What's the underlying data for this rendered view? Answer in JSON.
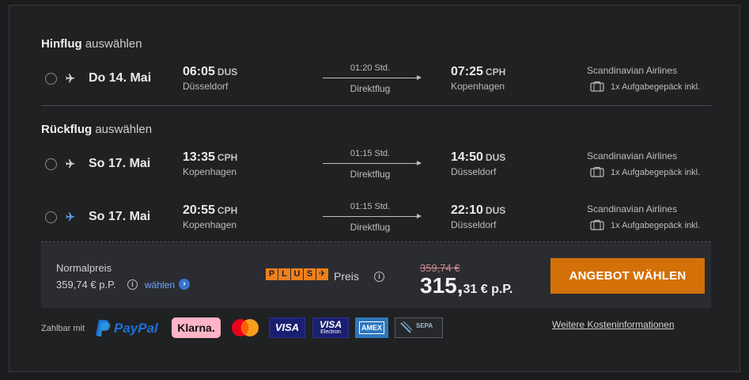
{
  "outbound": {
    "title_bold": "Hinflug",
    "title_rest": "auswählen",
    "flights": [
      {
        "date": "Do 14. Mai",
        "dep_time": "06:05",
        "dep_iata": "DUS",
        "dep_city": "Düsseldorf",
        "duration": "01:20 Std.",
        "stops": "Direktflug",
        "arr_time": "07:25",
        "arr_iata": "CPH",
        "arr_city": "Kopenhagen",
        "airline": "Scandinavian Airlines",
        "baggage": "1x Aufgabegepäck inkl."
      }
    ]
  },
  "return": {
    "title_bold": "Rückflug",
    "title_rest": "auswählen",
    "flights": [
      {
        "date": "So 17. Mai",
        "dep_time": "13:35",
        "dep_iata": "CPH",
        "dep_city": "Kopenhagen",
        "duration": "01:15 Std.",
        "stops": "Direktflug",
        "arr_time": "14:50",
        "arr_iata": "DUS",
        "arr_city": "Düsseldorf",
        "airline": "Scandinavian Airlines",
        "baggage": "1x Aufgabegepäck inkl."
      },
      {
        "date": "So 17. Mai",
        "dep_time": "20:55",
        "dep_iata": "CPH",
        "dep_city": "Kopenhagen",
        "duration": "01:15 Std.",
        "stops": "Direktflug",
        "arr_time": "22:10",
        "arr_iata": "DUS",
        "arr_city": "Düsseldorf",
        "airline": "Scandinavian Airlines",
        "baggage": "1x Aufgabegepäck inkl."
      }
    ]
  },
  "pricing": {
    "normal_label": "Normalpreis",
    "normal_price": "359,74 € p.P.",
    "select_label": "wählen",
    "plus_letters": [
      "P",
      "L",
      "U",
      "S",
      "✈"
    ],
    "plus_word": "Preis",
    "old_price": "359,74 €",
    "new_price_main": "315,",
    "new_price_cents": "31 € p.P.",
    "cta_label": "ANGEBOT WÄHLEN"
  },
  "payment": {
    "label": "Zahlbar mit",
    "methods": [
      "PayPal",
      "Klarna.",
      "mastercard",
      "VISA",
      "VISA Electron",
      "AMEX",
      "SEPA"
    ],
    "costs_link": "Weitere Kosteninformationen"
  },
  "colors": {
    "cta": "#d37008",
    "plus_orange": "#f07f1b",
    "link_blue": "#6fa8ff",
    "klarna_pink": "#ffb3c7",
    "paypal_blue": "#1e6fd9"
  },
  "icons": {
    "plane": "plane-icon",
    "bag": "suitcase-icon",
    "info": "info-icon",
    "chevron": "chevron-right-icon"
  }
}
